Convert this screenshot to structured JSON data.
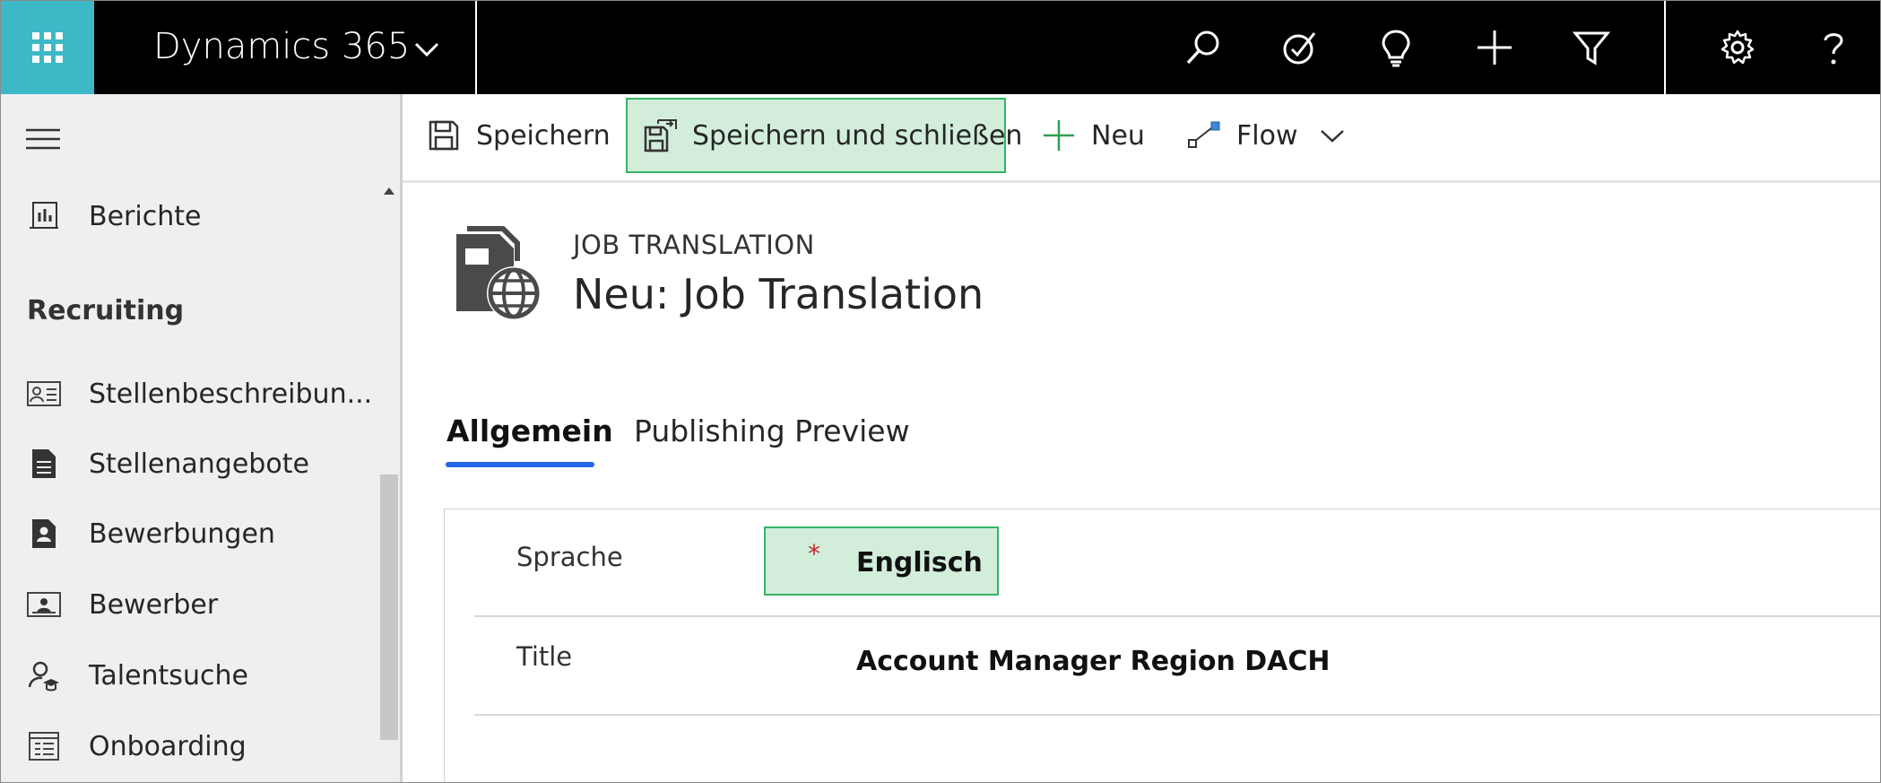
{
  "app": {
    "title": "Dynamics 365"
  },
  "topbar_icons": [
    "search-icon",
    "task-icon",
    "lightbulb-icon",
    "add-icon",
    "filter-icon",
    "settings-icon",
    "help-icon"
  ],
  "sidebar": {
    "items_top": [
      {
        "label": "Berichte",
        "icon": "reports-icon"
      }
    ],
    "group_label": "Recruiting",
    "items": [
      {
        "label": "Stellenbeschreibun...",
        "icon": "contact-card-icon"
      },
      {
        "label": "Stellenangebote",
        "icon": "document-icon"
      },
      {
        "label": "Bewerbungen",
        "icon": "application-icon"
      },
      {
        "label": "Bewerber",
        "icon": "person-card-icon"
      },
      {
        "label": "Talentsuche",
        "icon": "talent-icon"
      },
      {
        "label": "Onboarding",
        "icon": "checklist-icon"
      }
    ]
  },
  "commands": {
    "save": "Speichern",
    "save_close": "Speichern und schließen",
    "new": "Neu",
    "flow": "Flow"
  },
  "header": {
    "entity_type": "JOB TRANSLATION",
    "record_title": "Neu: Job Translation"
  },
  "tabs": [
    {
      "label": "Allgemein",
      "active": true
    },
    {
      "label": "Publishing Preview",
      "active": false
    }
  ],
  "form": {
    "fields": [
      {
        "label": "Sprache",
        "value": "Englisch",
        "required_marker": "*"
      },
      {
        "label": "Title",
        "value": "Account Manager Region DACH"
      }
    ]
  },
  "colors": {
    "topbar": "#000000",
    "waffle": "#3db8c6",
    "highlight_fill": "#d2eedb",
    "highlight_border": "#33b466",
    "tab_accent": "#2266e3",
    "required": "#c4262e"
  }
}
